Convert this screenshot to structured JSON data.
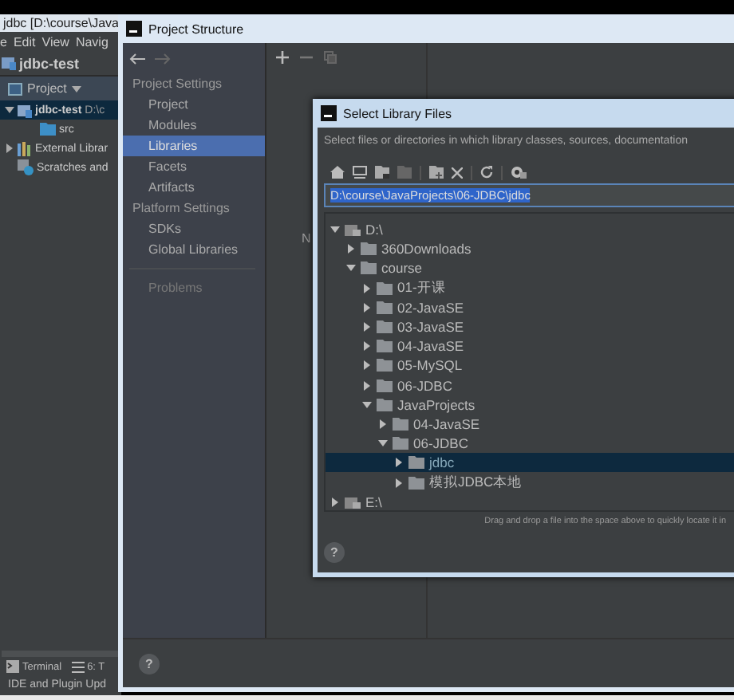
{
  "ide": {
    "title": "jdbc [D:\\course\\Java",
    "menu": [
      "e",
      "Edit",
      "View",
      "Navig"
    ],
    "breadcrumb": "jdbc-test",
    "panel_header": "Project",
    "tree": [
      {
        "kind": "module",
        "label": "jdbc-test",
        "note": "D:\\c",
        "expanded": true,
        "selected": true,
        "children": [
          {
            "kind": "folder",
            "label": "src",
            "selected": false
          }
        ]
      },
      {
        "kind": "library",
        "label": "External Librar",
        "expanded": false,
        "selected": false
      },
      {
        "kind": "scratches",
        "label": "Scratches and",
        "selected": false
      }
    ],
    "bottom_tabs": [
      {
        "kind": "terminal",
        "label": "Terminal"
      },
      {
        "kind": "list",
        "label": "6: T"
      }
    ],
    "status": "IDE and Plugin Upd"
  },
  "project_structure": {
    "title": "Project Structure",
    "sections": [
      {
        "heading": "Project Settings",
        "items": [
          {
            "label": "Project",
            "selected": false
          },
          {
            "label": "Modules",
            "selected": false
          },
          {
            "label": "Libraries",
            "selected": true
          },
          {
            "label": "Facets",
            "selected": false
          },
          {
            "label": "Artifacts",
            "selected": false
          }
        ]
      },
      {
        "heading": "Platform Settings",
        "items": [
          {
            "label": "SDKs",
            "selected": false
          },
          {
            "label": "Global Libraries",
            "selected": false
          }
        ]
      }
    ],
    "problems": "Problems",
    "content_text": "N",
    "help": "?"
  },
  "dialog": {
    "title": "Select Library Files",
    "description": "Select files or directories in which library classes, sources, documentation",
    "path": "D:\\course\\JavaProjects\\06-JDBC\\jdbc",
    "tree": [
      {
        "kind": "drive",
        "label": "D:\\",
        "expanded": true,
        "selected": false,
        "children": [
          {
            "kind": "folder",
            "label": "360Downloads",
            "expanded": false,
            "selected": false
          },
          {
            "kind": "folder",
            "label": "course",
            "expanded": true,
            "selected": false,
            "children": [
              {
                "kind": "folder",
                "label": "01-开课",
                "expanded": false,
                "selected": false
              },
              {
                "kind": "folder",
                "label": "02-JavaSE",
                "expanded": false,
                "selected": false
              },
              {
                "kind": "folder",
                "label": "03-JavaSE",
                "expanded": false,
                "selected": false
              },
              {
                "kind": "folder",
                "label": "04-JavaSE",
                "expanded": false,
                "selected": false
              },
              {
                "kind": "folder",
                "label": "05-MySQL",
                "expanded": false,
                "selected": false
              },
              {
                "kind": "folder",
                "label": "06-JDBC",
                "expanded": false,
                "selected": false
              },
              {
                "kind": "folder",
                "label": "JavaProjects",
                "expanded": true,
                "selected": false,
                "children": [
                  {
                    "kind": "folder",
                    "label": "04-JavaSE",
                    "expanded": false,
                    "selected": false
                  },
                  {
                    "kind": "folder",
                    "label": "06-JDBC",
                    "expanded": true,
                    "selected": false,
                    "children": [
                      {
                        "kind": "folder",
                        "label": "jdbc",
                        "expanded": false,
                        "selected": true
                      },
                      {
                        "kind": "folder",
                        "label": "模拟JDBC本地",
                        "expanded": false,
                        "selected": false
                      }
                    ]
                  }
                ]
              }
            ]
          }
        ]
      },
      {
        "kind": "drive",
        "label": "E:\\",
        "expanded": false,
        "selected": false
      }
    ],
    "hint": "Drag and drop a file into the space above to quickly locate it in",
    "help": "?"
  }
}
